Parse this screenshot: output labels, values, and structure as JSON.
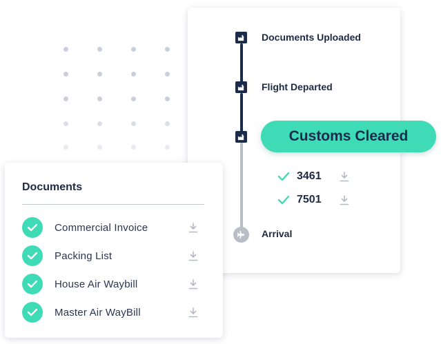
{
  "timeline": {
    "steps": [
      {
        "label": "Documents Uploaded",
        "state": "complete"
      },
      {
        "label": "Flight Departed",
        "state": "complete"
      },
      {
        "label": "Customs Cleared",
        "state": "current"
      },
      {
        "label": "Arrival",
        "state": "pending"
      }
    ],
    "current_status": "Customs Cleared",
    "references": [
      {
        "number": "3461"
      },
      {
        "number": "7501"
      }
    ]
  },
  "documents": {
    "title": "Documents",
    "items": [
      {
        "label": "Commercial Invoice",
        "status": "complete"
      },
      {
        "label": "Packing List",
        "status": "complete"
      },
      {
        "label": "House Air Waybill",
        "status": "complete"
      },
      {
        "label": "Master Air WayBill",
        "status": "complete"
      }
    ]
  },
  "icons": {
    "timeline_step": "building-icon",
    "arrival": "airplane-icon",
    "reference_check": "check-icon",
    "document_check": "check-circle-icon",
    "download": "download-icon"
  },
  "colors": {
    "accent": "#3fdbb6",
    "navy": "#1a2b4c",
    "pending": "#b9bdc6",
    "download": "#b5b9c3"
  }
}
